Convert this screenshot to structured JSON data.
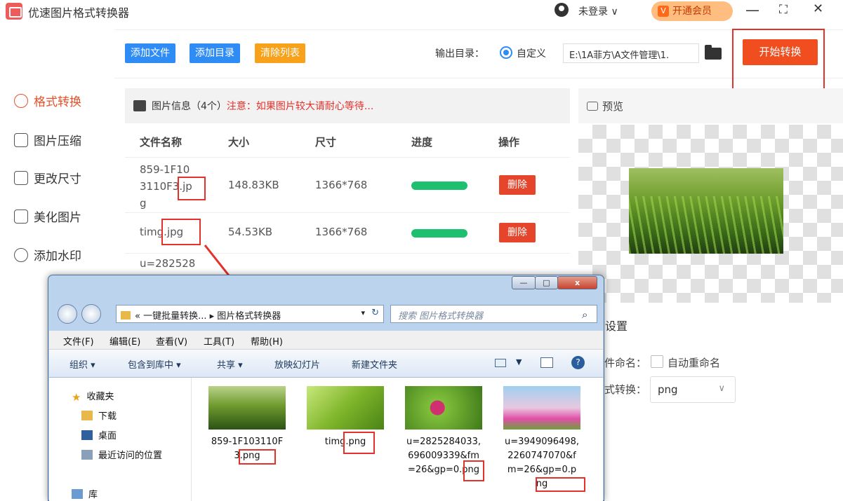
{
  "app": {
    "title": "优速图片格式转换器",
    "login": "未登录 ∨",
    "vip": "开通会员",
    "vip_icon": "V",
    "ctrl_min": "—",
    "ctrl_max": "⛶",
    "ctrl_close": "✕"
  },
  "toolbar": {
    "add_file": "添加文件",
    "add_dir": "添加目录",
    "clear_list": "清除列表",
    "output_label": "输出目录：",
    "custom_label": "自定义",
    "output_path": "E:\\1A菲方\\A文件管理\\1.",
    "start": "开始转换"
  },
  "sidebar": {
    "items": [
      {
        "label": "格式转换",
        "icon": "format-convert-icon"
      },
      {
        "label": "图片压缩",
        "icon": "compress-icon"
      },
      {
        "label": "更改尺寸",
        "icon": "resize-icon"
      },
      {
        "label": "美化图片",
        "icon": "beautify-icon"
      },
      {
        "label": "添加水印",
        "icon": "watermark-icon"
      }
    ]
  },
  "table": {
    "info": "图片信息（4个）",
    "warning": "注意：如果图片较大请耐心等待...",
    "headers": [
      "文件名称",
      "大小",
      "尺寸",
      "进度",
      "操作"
    ],
    "rows": [
      {
        "name_l1": "859-1F10",
        "name_l2": "3110F3.jp",
        "name_l3": "g",
        "size": "148.83KB",
        "dim": "1366*768",
        "progress": 1.0,
        "action": "删除"
      },
      {
        "name_l1": "timg.jpg",
        "size": "54.53KB",
        "dim": "1366*768",
        "progress": 1.0,
        "action": "删除"
      },
      {
        "name_l1": "u=282528"
      }
    ]
  },
  "preview": {
    "title": "预览"
  },
  "settings": {
    "title": "设置",
    "rename_label": "件命名：",
    "rename_option": "自动重命名",
    "convert_label": "式转换：",
    "format": "png"
  },
  "explorer": {
    "ctrl_min": "—",
    "ctrl_max": "□",
    "ctrl_close": "x",
    "address": "« 一键批量转换... ▸ 图片格式转换器",
    "search_placeholder": "搜索 图片格式转换器",
    "menu": [
      "文件(F)",
      "编辑(E)",
      "查看(V)",
      "工具(T)",
      "帮助(H)"
    ],
    "commands": [
      "组织 ▾",
      "包含到库中 ▾",
      "共享 ▾",
      "放映幻灯片",
      "新建文件夹"
    ],
    "nav": [
      "收藏夹",
      "下载",
      "桌面",
      "最近访问的位置",
      "库"
    ],
    "files": [
      {
        "name": "859-1F103110F3.png",
        "l1": "859-1F103110F",
        "l2": "3.png"
      },
      {
        "name": "timg.png",
        "l1": "timg.png",
        "l2": ""
      },
      {
        "name": "u=2825284033,696009339&fm=26&gp=0.png",
        "l1": "u=2825284033,",
        "l2": "696009339&fm",
        "l3": "=26&gp=0.png"
      },
      {
        "name": "u=3949096498,2260747070&fm=26&gp=0.png",
        "l1": "u=3949096498,",
        "l2": "2260747070&f",
        "l3": "m=26&gp=0.p",
        "l4": "ng"
      }
    ]
  },
  "colors": {
    "accent": "#f04e1f",
    "blue": "#2f8cf5",
    "progress": "#1ec070",
    "annotation": "#e5312a"
  }
}
